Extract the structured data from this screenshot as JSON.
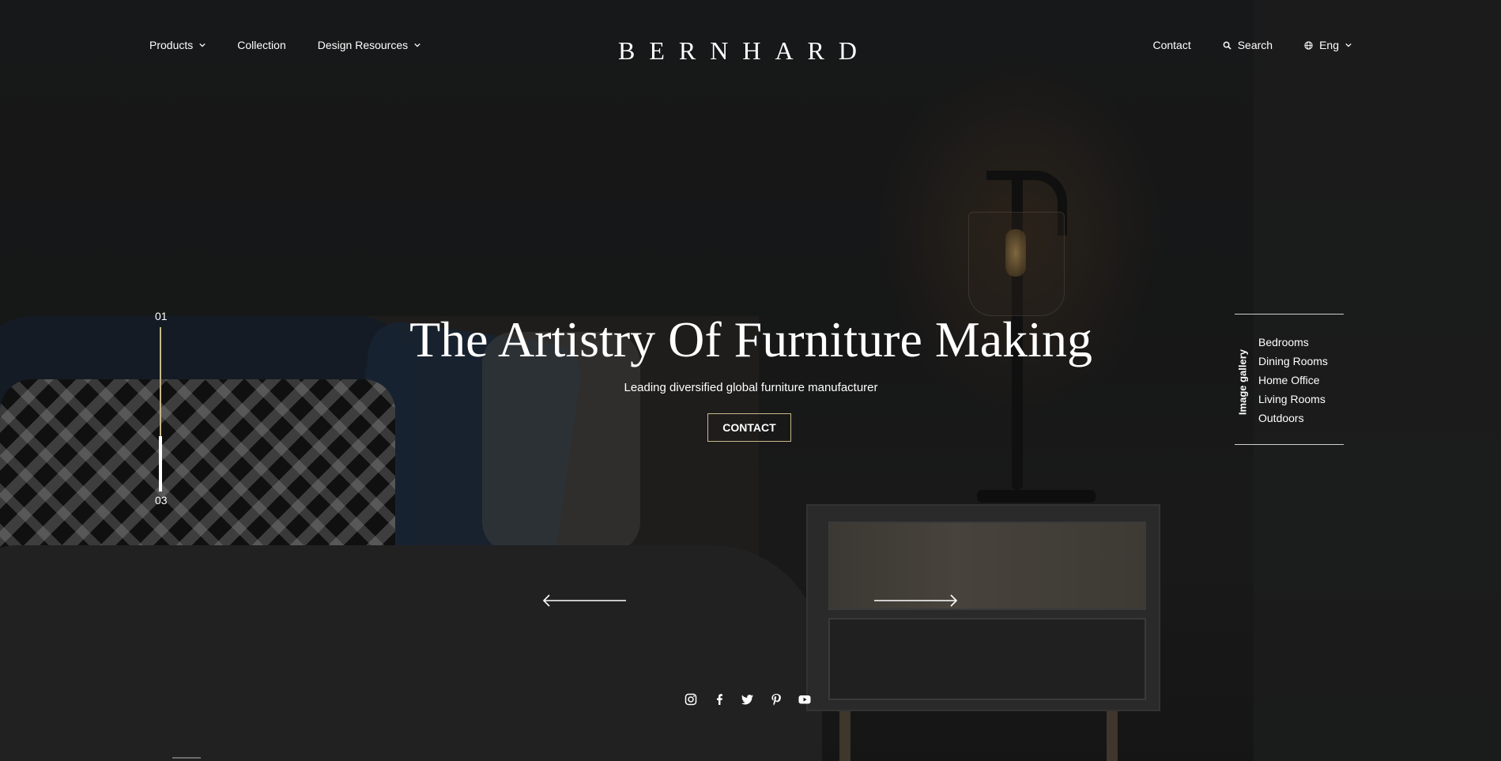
{
  "brand": {
    "name": "BERNHARD"
  },
  "nav": {
    "left": [
      {
        "label": "Products",
        "has_dropdown": true
      },
      {
        "label": "Collection",
        "has_dropdown": false
      },
      {
        "label": "Design Resources",
        "has_dropdown": true
      }
    ],
    "contact_label": "Contact",
    "search_label": "Search",
    "language_label": "Eng"
  },
  "slider": {
    "current": "01",
    "total": "03",
    "progress": 0.33
  },
  "hero": {
    "title": "The Artistry Of Furniture Making",
    "subtitle": "Leading diversified global furniture manufacturer",
    "cta_label": "CONTACT"
  },
  "gallery": {
    "label": "Image gallery",
    "items": [
      "Bedrooms",
      "Dining Rooms",
      "Home Office",
      "Living Rooms",
      "Outdoors"
    ]
  },
  "social": [
    "instagram-icon",
    "facebook-icon",
    "twitter-icon",
    "pinterest-icon",
    "youtube-icon"
  ],
  "colors": {
    "accent": "#c8b88a",
    "text": "#ffffff",
    "background": "#1c1d1e"
  }
}
